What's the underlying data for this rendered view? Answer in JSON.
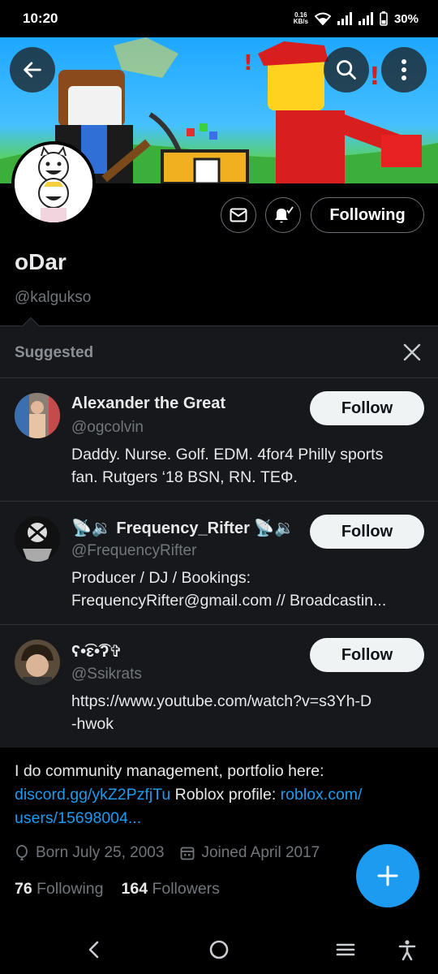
{
  "status_bar": {
    "time": "10:20",
    "net_speed_value": "0.16",
    "net_speed_unit": "KB/s",
    "battery": "30%"
  },
  "profile": {
    "display_name": "oDar",
    "handle": "@kalgukso",
    "following_label": "Following",
    "bio_text": "I do community management, portfolio here:",
    "bio_link_1": "discord.gg/ykZ2PzfjTu",
    "bio_mid": " Roblox profile: ",
    "bio_link_2a": "roblox.com/",
    "bio_link_2b": "users/15698004...",
    "born": "Born July 25, 2003",
    "joined": "Joined April 2017",
    "following_count": "76",
    "following_text": "Following",
    "followers_count": "164",
    "followers_text": "Followers"
  },
  "suggested": {
    "title": "Suggested",
    "items": [
      {
        "name": "Alexander the Great",
        "handle": "@ogcolvin",
        "bio_line_1": "Daddy. Nurse. Golf. EDM. 4for4 Philly sports",
        "bio_line_2": "fan. Rutgers ‘18 BSN, RN. ΤΕΦ.",
        "follow_label": "Follow"
      },
      {
        "name": "📡🔉 Frequency_Rifter 📡🔉",
        "handle": "@FrequencyRifter",
        "bio_line_1": "Producer / DJ / Bookings:",
        "bio_line_2": "FrequencyRifter@gmail.com // Broadcastin...",
        "follow_label": "Follow"
      },
      {
        "name": "ʕ•͡ɛ•͡ʔ✞",
        "handle": "@Ssikrats",
        "bio_line_1": "https://www.youtube.com/watch?v=s3Yh-D",
        "bio_line_2": "-hwok",
        "follow_label": "Follow"
      }
    ]
  },
  "colors": {
    "accent": "#1d9bf0",
    "background": "#000000",
    "panel": "#16181c",
    "secondary_text": "#71767b"
  }
}
